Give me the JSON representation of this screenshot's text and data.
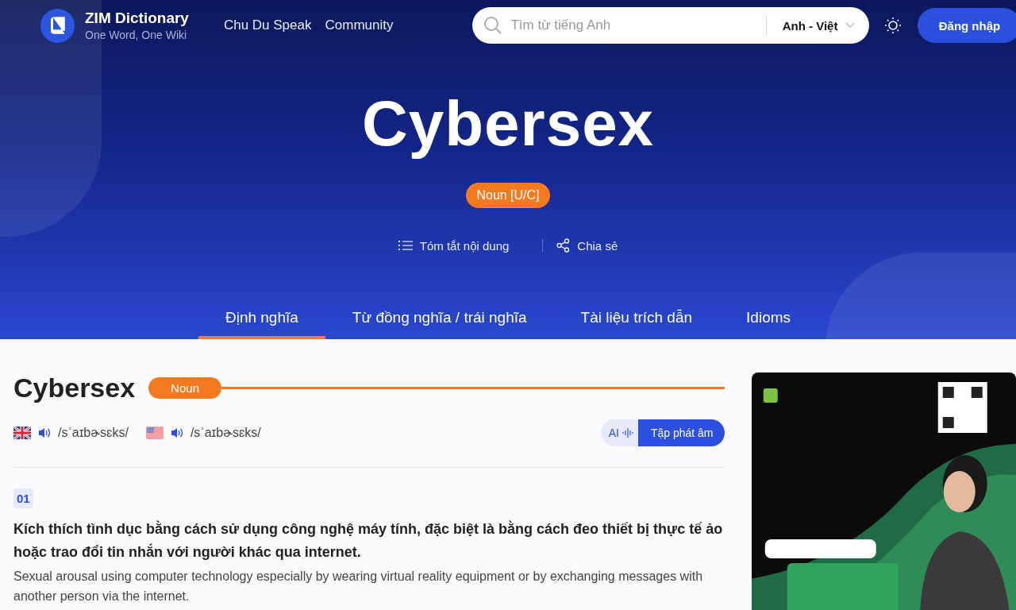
{
  "brand": {
    "name": "ZIM Dictionary",
    "tagline": "One Word, One Wiki"
  },
  "nav": [
    "Chu Du Speak",
    "Community"
  ],
  "search": {
    "placeholder": "Tìm từ tiếng Anh",
    "language": "Anh - Việt"
  },
  "login": "Đăng nhập",
  "hero": {
    "word": "Cybersex",
    "pos": "Noun [U/C]",
    "actions": [
      {
        "kind": "summary",
        "label": "Tóm tắt nội dung"
      },
      {
        "kind": "share",
        "label": "Chia sẻ"
      }
    ]
  },
  "tabs": [
    {
      "label": "Định nghĩa",
      "selected": true
    },
    {
      "label": "Từ đồng nghĩa / trái nghĩa",
      "selected": false
    },
    {
      "label": "Tài liệu trích dẫn",
      "selected": false
    },
    {
      "label": "Idioms",
      "selected": false
    }
  ],
  "entry": {
    "word": "Cybersex",
    "pos": "Noun",
    "pronunciations": [
      {
        "kind": "uk",
        "ipa": "/sˈaɪbɚsɛks/"
      },
      {
        "kind": "us",
        "ipa": "/sˈaɪbɚsɛks/"
      }
    ],
    "practice": {
      "ai": "AI",
      "label": "Tập phát âm"
    },
    "senses": [
      {
        "number": "01",
        "vi": "Kích thích tình dục bằng cách sử dụng công nghệ máy tính, đặc biệt là bằng cách đeo thiết bị thực tế ảo hoặc trao đổi tin nhắn với người khác qua internet.",
        "en": "Sexual arousal using computer technology especially by wearing virtual reality equipment or by exchanging messages with another person via the internet."
      }
    ]
  }
}
